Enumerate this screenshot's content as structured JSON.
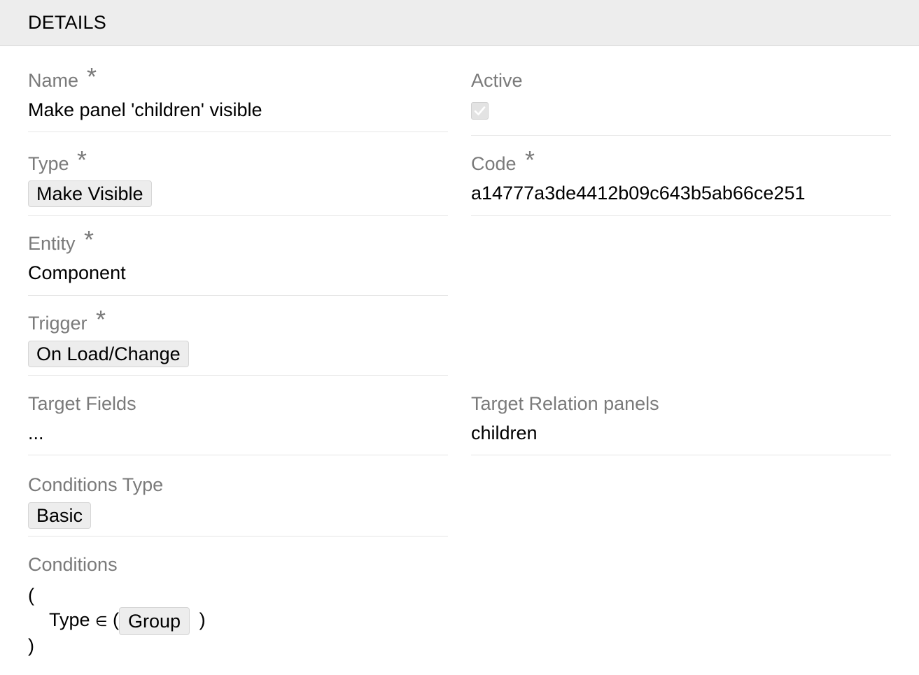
{
  "panel": {
    "title": "DETAILS"
  },
  "fields": {
    "name": {
      "label": "Name",
      "required": "*",
      "value": "Make panel 'children' visible"
    },
    "active": {
      "label": "Active",
      "checked": true
    },
    "type": {
      "label": "Type",
      "required": "*",
      "value": "Make Visible"
    },
    "code": {
      "label": "Code",
      "required": "*",
      "value": "a14777a3de4412b09c643b5ab66ce251"
    },
    "entity": {
      "label": "Entity",
      "required": "*",
      "value": "Component"
    },
    "trigger": {
      "label": "Trigger",
      "required": "*",
      "value": "On Load/Change"
    },
    "target_fields": {
      "label": "Target Fields",
      "value": "..."
    },
    "target_relation_panels": {
      "label": "Target Relation panels",
      "value": "children"
    },
    "conditions_type": {
      "label": "Conditions Type",
      "value": "Basic"
    },
    "conditions": {
      "label": "Conditions",
      "open_paren": "(",
      "field": "Type",
      "operator": "∈",
      "inner_open": "(",
      "value": "Group",
      "inner_close": ")",
      "close_paren": ")"
    }
  },
  "icons": {
    "required": "asterisk-icon",
    "checkmark": "checkmark-icon"
  }
}
